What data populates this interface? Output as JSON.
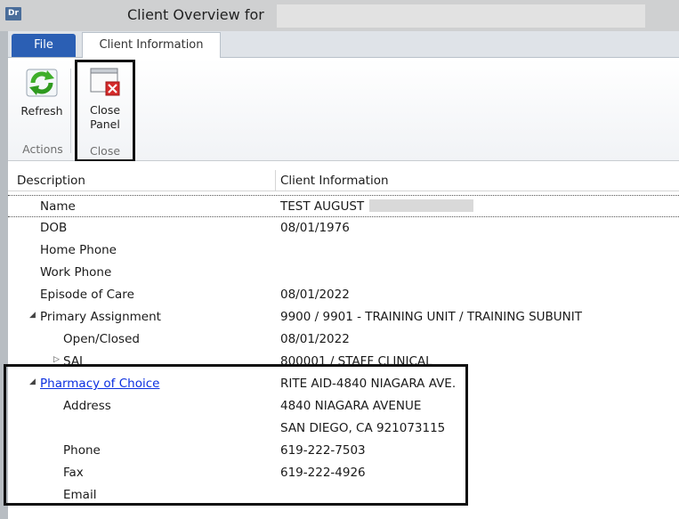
{
  "window": {
    "app_icon_text": "Dr",
    "title": "Client Overview for"
  },
  "tabs": {
    "file": "File",
    "client_information": "Client Information"
  },
  "ribbon": {
    "actions_group_label": "Actions",
    "close_group_label": "Close",
    "refresh_label": "Refresh",
    "close_panel_label_1": "Close",
    "close_panel_label_2": "Panel"
  },
  "grid": {
    "columns": [
      "Description",
      "Client Information"
    ],
    "rows": [
      {
        "description": "Name",
        "value": "TEST AUGUST"
      },
      {
        "description": "DOB",
        "value": "08/01/1976"
      },
      {
        "description": "Home Phone",
        "value": ""
      },
      {
        "description": "Work Phone",
        "value": ""
      },
      {
        "description": "Episode of Care",
        "value": "08/01/2022"
      },
      {
        "description": "Primary Assignment",
        "value": "9900 / 9901 - TRAINING UNIT / TRAINING SUBUNIT"
      },
      {
        "description": "Open/Closed",
        "value": "08/01/2022"
      },
      {
        "description": "SAI",
        "value": "800001 / STAFF CLINICAL"
      },
      {
        "description": "Pharmacy of Choice",
        "value": "RITE AID-4840 NIAGARA AVE."
      },
      {
        "description": "Address",
        "value": "4840 NIAGARA AVENUE"
      },
      {
        "description": "",
        "value": "SAN DIEGO, CA 921073115"
      },
      {
        "description": "Phone",
        "value": "619-222-7503"
      },
      {
        "description": "Fax",
        "value": "619-222-4926"
      },
      {
        "description": "Email",
        "value": ""
      }
    ]
  },
  "colors": {
    "file_tab": "#2b5fb4",
    "link": "#0b2fe0",
    "highlight_border": "#111111"
  }
}
